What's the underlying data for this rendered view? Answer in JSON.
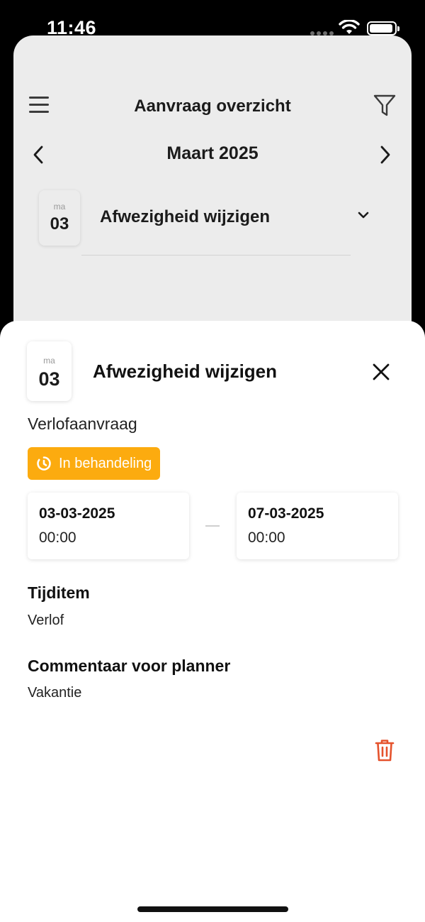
{
  "status_bar": {
    "time": "11:46"
  },
  "background": {
    "header": {
      "title": "Aanvraag overzicht"
    },
    "month": "Maart 2025",
    "entry": {
      "dow": "ma",
      "day": "03",
      "title": "Afwezigheid wijzigen"
    }
  },
  "sheet": {
    "dow": "ma",
    "day": "03",
    "title": "Afwezigheid wijzigen",
    "type": "Verlofaanvraag",
    "status": "In behandeling",
    "status_color": "#fcab0f",
    "start": {
      "date": "03-03-2025",
      "time": "00:00"
    },
    "end": {
      "date": "07-03-2025",
      "time": "00:00"
    },
    "sections": [
      {
        "label": "Tijditem",
        "value": "Verlof"
      },
      {
        "label": "Commentaar voor planner",
        "value": "Vakantie"
      }
    ],
    "delete_color": "#e5522c"
  }
}
